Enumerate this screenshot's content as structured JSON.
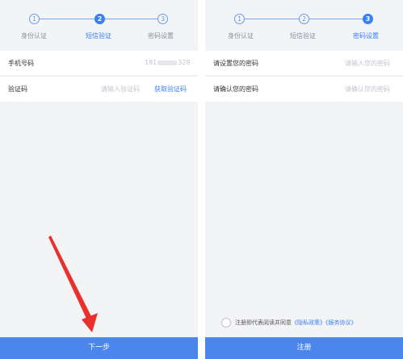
{
  "left_screen": {
    "steps": [
      {
        "number": "1",
        "label": "身份认证",
        "active": false
      },
      {
        "number": "2",
        "label": "短信验证",
        "active": true
      },
      {
        "number": "3",
        "label": "密码设置",
        "active": false
      }
    ],
    "phone": {
      "label": "手机号码",
      "value_prefix": "181",
      "value_suffix": "328"
    },
    "code": {
      "label": "验证码",
      "placeholder": "请输入验证码",
      "get_code": "获取验证码"
    },
    "next_button": "下一步"
  },
  "right_screen": {
    "steps": [
      {
        "number": "1",
        "label": "身份认证",
        "active": false
      },
      {
        "number": "2",
        "label": "短信验证",
        "active": false
      },
      {
        "number": "3",
        "label": "密码设置",
        "active": true
      }
    ],
    "set_password": {
      "label": "请设置您的密码",
      "placeholder": "请输入您的密码"
    },
    "confirm_password": {
      "label": "请确认您的密码",
      "placeholder": "请确认您的密码"
    },
    "agreement": {
      "text": "注册即代表阅读并同意",
      "privacy": "《隐私政策》",
      "service": "《服务协议》"
    },
    "register_button": "注册"
  },
  "colors": {
    "accent": "#3a7ff0",
    "button": "#4a86ee",
    "arrow": "#e8302c",
    "background": "#f3f4f6"
  }
}
